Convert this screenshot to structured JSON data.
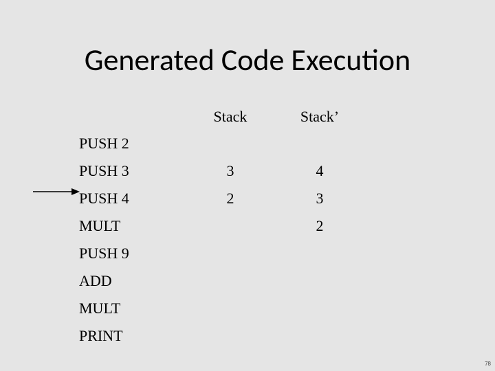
{
  "title": "Generated Code Execution",
  "headers": {
    "stack": "Stack",
    "stackp": "Stack’"
  },
  "instructions": [
    {
      "label": "PUSH 2",
      "stack": "",
      "stackp": ""
    },
    {
      "label": "PUSH 3",
      "stack": "3",
      "stackp": "4"
    },
    {
      "label": "PUSH 4",
      "stack": "2",
      "stackp": "3"
    },
    {
      "label": "MULT",
      "stack": "",
      "stackp": "2"
    },
    {
      "label": "PUSH 9",
      "stack": "",
      "stackp": ""
    },
    {
      "label": "ADD",
      "stack": "",
      "stackp": ""
    },
    {
      "label": "MULT",
      "stack": "",
      "stackp": ""
    },
    {
      "label": "PRINT",
      "stack": "",
      "stackp": ""
    }
  ],
  "page_number": "78",
  "arrow_target_index": 2
}
